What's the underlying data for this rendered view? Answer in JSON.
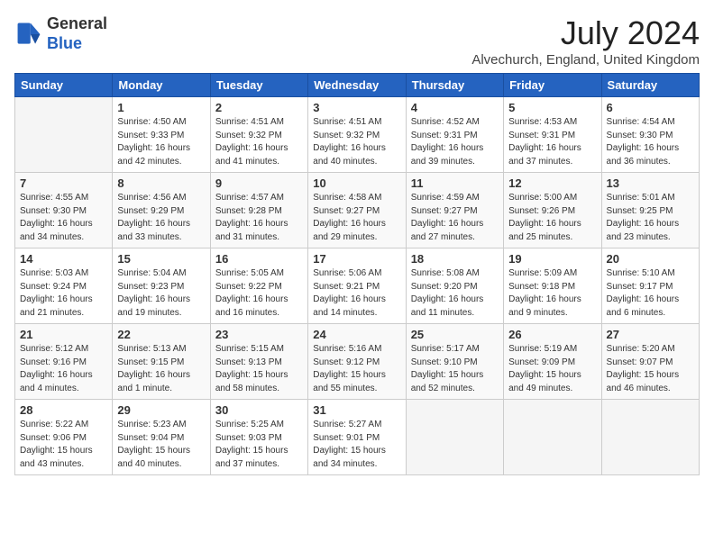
{
  "header": {
    "logo_general": "General",
    "logo_blue": "Blue",
    "month_year": "July 2024",
    "location": "Alvechurch, England, United Kingdom"
  },
  "days_of_week": [
    "Sunday",
    "Monday",
    "Tuesday",
    "Wednesday",
    "Thursday",
    "Friday",
    "Saturday"
  ],
  "weeks": [
    [
      {
        "num": "",
        "info": ""
      },
      {
        "num": "1",
        "info": "Sunrise: 4:50 AM\nSunset: 9:33 PM\nDaylight: 16 hours\nand 42 minutes."
      },
      {
        "num": "2",
        "info": "Sunrise: 4:51 AM\nSunset: 9:32 PM\nDaylight: 16 hours\nand 41 minutes."
      },
      {
        "num": "3",
        "info": "Sunrise: 4:51 AM\nSunset: 9:32 PM\nDaylight: 16 hours\nand 40 minutes."
      },
      {
        "num": "4",
        "info": "Sunrise: 4:52 AM\nSunset: 9:31 PM\nDaylight: 16 hours\nand 39 minutes."
      },
      {
        "num": "5",
        "info": "Sunrise: 4:53 AM\nSunset: 9:31 PM\nDaylight: 16 hours\nand 37 minutes."
      },
      {
        "num": "6",
        "info": "Sunrise: 4:54 AM\nSunset: 9:30 PM\nDaylight: 16 hours\nand 36 minutes."
      }
    ],
    [
      {
        "num": "7",
        "info": "Sunrise: 4:55 AM\nSunset: 9:30 PM\nDaylight: 16 hours\nand 34 minutes."
      },
      {
        "num": "8",
        "info": "Sunrise: 4:56 AM\nSunset: 9:29 PM\nDaylight: 16 hours\nand 33 minutes."
      },
      {
        "num": "9",
        "info": "Sunrise: 4:57 AM\nSunset: 9:28 PM\nDaylight: 16 hours\nand 31 minutes."
      },
      {
        "num": "10",
        "info": "Sunrise: 4:58 AM\nSunset: 9:27 PM\nDaylight: 16 hours\nand 29 minutes."
      },
      {
        "num": "11",
        "info": "Sunrise: 4:59 AM\nSunset: 9:27 PM\nDaylight: 16 hours\nand 27 minutes."
      },
      {
        "num": "12",
        "info": "Sunrise: 5:00 AM\nSunset: 9:26 PM\nDaylight: 16 hours\nand 25 minutes."
      },
      {
        "num": "13",
        "info": "Sunrise: 5:01 AM\nSunset: 9:25 PM\nDaylight: 16 hours\nand 23 minutes."
      }
    ],
    [
      {
        "num": "14",
        "info": "Sunrise: 5:03 AM\nSunset: 9:24 PM\nDaylight: 16 hours\nand 21 minutes."
      },
      {
        "num": "15",
        "info": "Sunrise: 5:04 AM\nSunset: 9:23 PM\nDaylight: 16 hours\nand 19 minutes."
      },
      {
        "num": "16",
        "info": "Sunrise: 5:05 AM\nSunset: 9:22 PM\nDaylight: 16 hours\nand 16 minutes."
      },
      {
        "num": "17",
        "info": "Sunrise: 5:06 AM\nSunset: 9:21 PM\nDaylight: 16 hours\nand 14 minutes."
      },
      {
        "num": "18",
        "info": "Sunrise: 5:08 AM\nSunset: 9:20 PM\nDaylight: 16 hours\nand 11 minutes."
      },
      {
        "num": "19",
        "info": "Sunrise: 5:09 AM\nSunset: 9:18 PM\nDaylight: 16 hours\nand 9 minutes."
      },
      {
        "num": "20",
        "info": "Sunrise: 5:10 AM\nSunset: 9:17 PM\nDaylight: 16 hours\nand 6 minutes."
      }
    ],
    [
      {
        "num": "21",
        "info": "Sunrise: 5:12 AM\nSunset: 9:16 PM\nDaylight: 16 hours\nand 4 minutes."
      },
      {
        "num": "22",
        "info": "Sunrise: 5:13 AM\nSunset: 9:15 PM\nDaylight: 16 hours\nand 1 minute."
      },
      {
        "num": "23",
        "info": "Sunrise: 5:15 AM\nSunset: 9:13 PM\nDaylight: 15 hours\nand 58 minutes."
      },
      {
        "num": "24",
        "info": "Sunrise: 5:16 AM\nSunset: 9:12 PM\nDaylight: 15 hours\nand 55 minutes."
      },
      {
        "num": "25",
        "info": "Sunrise: 5:17 AM\nSunset: 9:10 PM\nDaylight: 15 hours\nand 52 minutes."
      },
      {
        "num": "26",
        "info": "Sunrise: 5:19 AM\nSunset: 9:09 PM\nDaylight: 15 hours\nand 49 minutes."
      },
      {
        "num": "27",
        "info": "Sunrise: 5:20 AM\nSunset: 9:07 PM\nDaylight: 15 hours\nand 46 minutes."
      }
    ],
    [
      {
        "num": "28",
        "info": "Sunrise: 5:22 AM\nSunset: 9:06 PM\nDaylight: 15 hours\nand 43 minutes."
      },
      {
        "num": "29",
        "info": "Sunrise: 5:23 AM\nSunset: 9:04 PM\nDaylight: 15 hours\nand 40 minutes."
      },
      {
        "num": "30",
        "info": "Sunrise: 5:25 AM\nSunset: 9:03 PM\nDaylight: 15 hours\nand 37 minutes."
      },
      {
        "num": "31",
        "info": "Sunrise: 5:27 AM\nSunset: 9:01 PM\nDaylight: 15 hours\nand 34 minutes."
      },
      {
        "num": "",
        "info": ""
      },
      {
        "num": "",
        "info": ""
      },
      {
        "num": "",
        "info": ""
      }
    ]
  ]
}
